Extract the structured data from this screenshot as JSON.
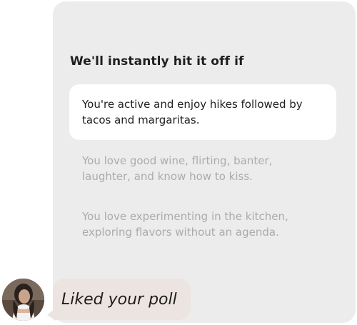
{
  "poll": {
    "title": "We'll instantly hit it off if",
    "options": [
      {
        "text": "You're active and enjoy hikes followed by tacos and margaritas.",
        "selected": true
      },
      {
        "text": "You love good wine, flirting, banter, laughter, and know how to kiss.",
        "selected": false
      },
      {
        "text": "You love experimenting in the kitchen, exploring flavors without an agenda.",
        "selected": false
      }
    ]
  },
  "reply": {
    "text": "Liked your poll"
  },
  "colors": {
    "card_background": "#ececec",
    "selected_option_background": "#ffffff",
    "unselected_text": "#ababab",
    "reply_bubble": "#ece4e0",
    "primary_text": "#1e1e1e"
  }
}
